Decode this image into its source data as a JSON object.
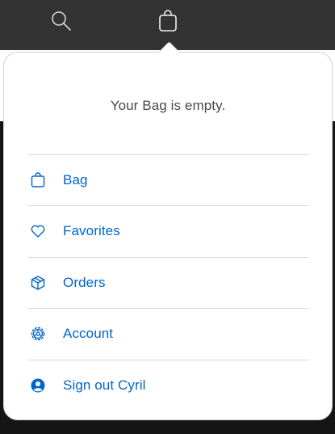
{
  "header": {
    "icons": [
      "search-icon",
      "bag-icon"
    ]
  },
  "bag": {
    "empty_message": "Your Bag is empty."
  },
  "menu": {
    "items": [
      {
        "label": "Bag",
        "icon": "bag-icon"
      },
      {
        "label": "Favorites",
        "icon": "heart-icon"
      },
      {
        "label": "Orders",
        "icon": "box-icon"
      },
      {
        "label": "Account",
        "icon": "gear-icon"
      },
      {
        "label": "Sign out Cyril",
        "icon": "user-circle-icon"
      }
    ]
  },
  "colors": {
    "link": "#0066cc",
    "topbar": "#333333",
    "text": "#4b4b4f",
    "divider": "#d8d8dc"
  }
}
